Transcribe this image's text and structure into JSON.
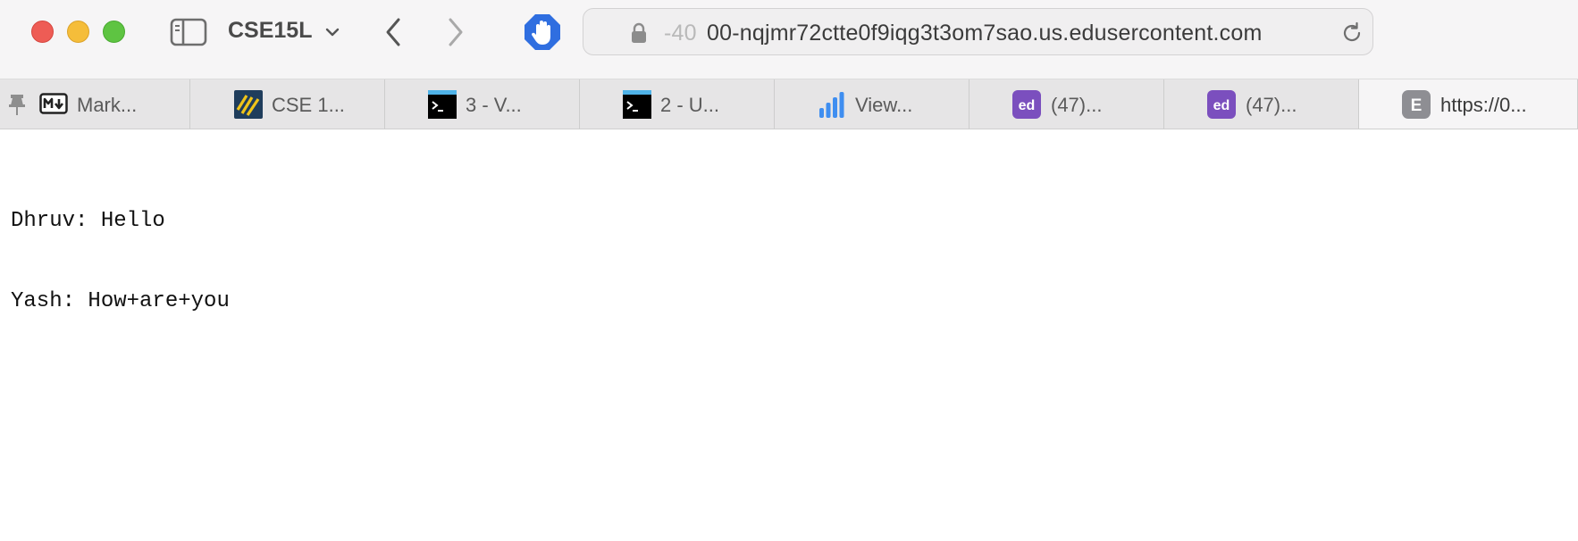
{
  "window": {
    "tab_group": "CSE15L",
    "url_faded_prefix": "-40",
    "url": "00-nqjmr72ctte0f9iqg3t3om7sao.us.edusercontent.com"
  },
  "tabs": [
    {
      "label": "Mark...",
      "icon": "pin-icon"
    },
    {
      "label": "CSE 1...",
      "icon": "stripes-favicon"
    },
    {
      "label": "3 - V...",
      "icon": "terminal-favicon"
    },
    {
      "label": "2 - U...",
      "icon": "terminal-favicon"
    },
    {
      "label": "View...",
      "icon": "bar-chart-favicon"
    },
    {
      "label": "(47)...",
      "icon": "ed-favicon"
    },
    {
      "label": "(47)...",
      "icon": "ed-favicon"
    },
    {
      "label": "https://0...",
      "icon": "e-letter-favicon"
    }
  ],
  "page": {
    "lines": [
      "Dhruv: Hello",
      "Yash: How+are+you"
    ]
  },
  "colors": {
    "ed_purple": "#7b4fbe",
    "ext_blue": "#2f6ee0",
    "chart_blue": "#3f8ef0"
  }
}
